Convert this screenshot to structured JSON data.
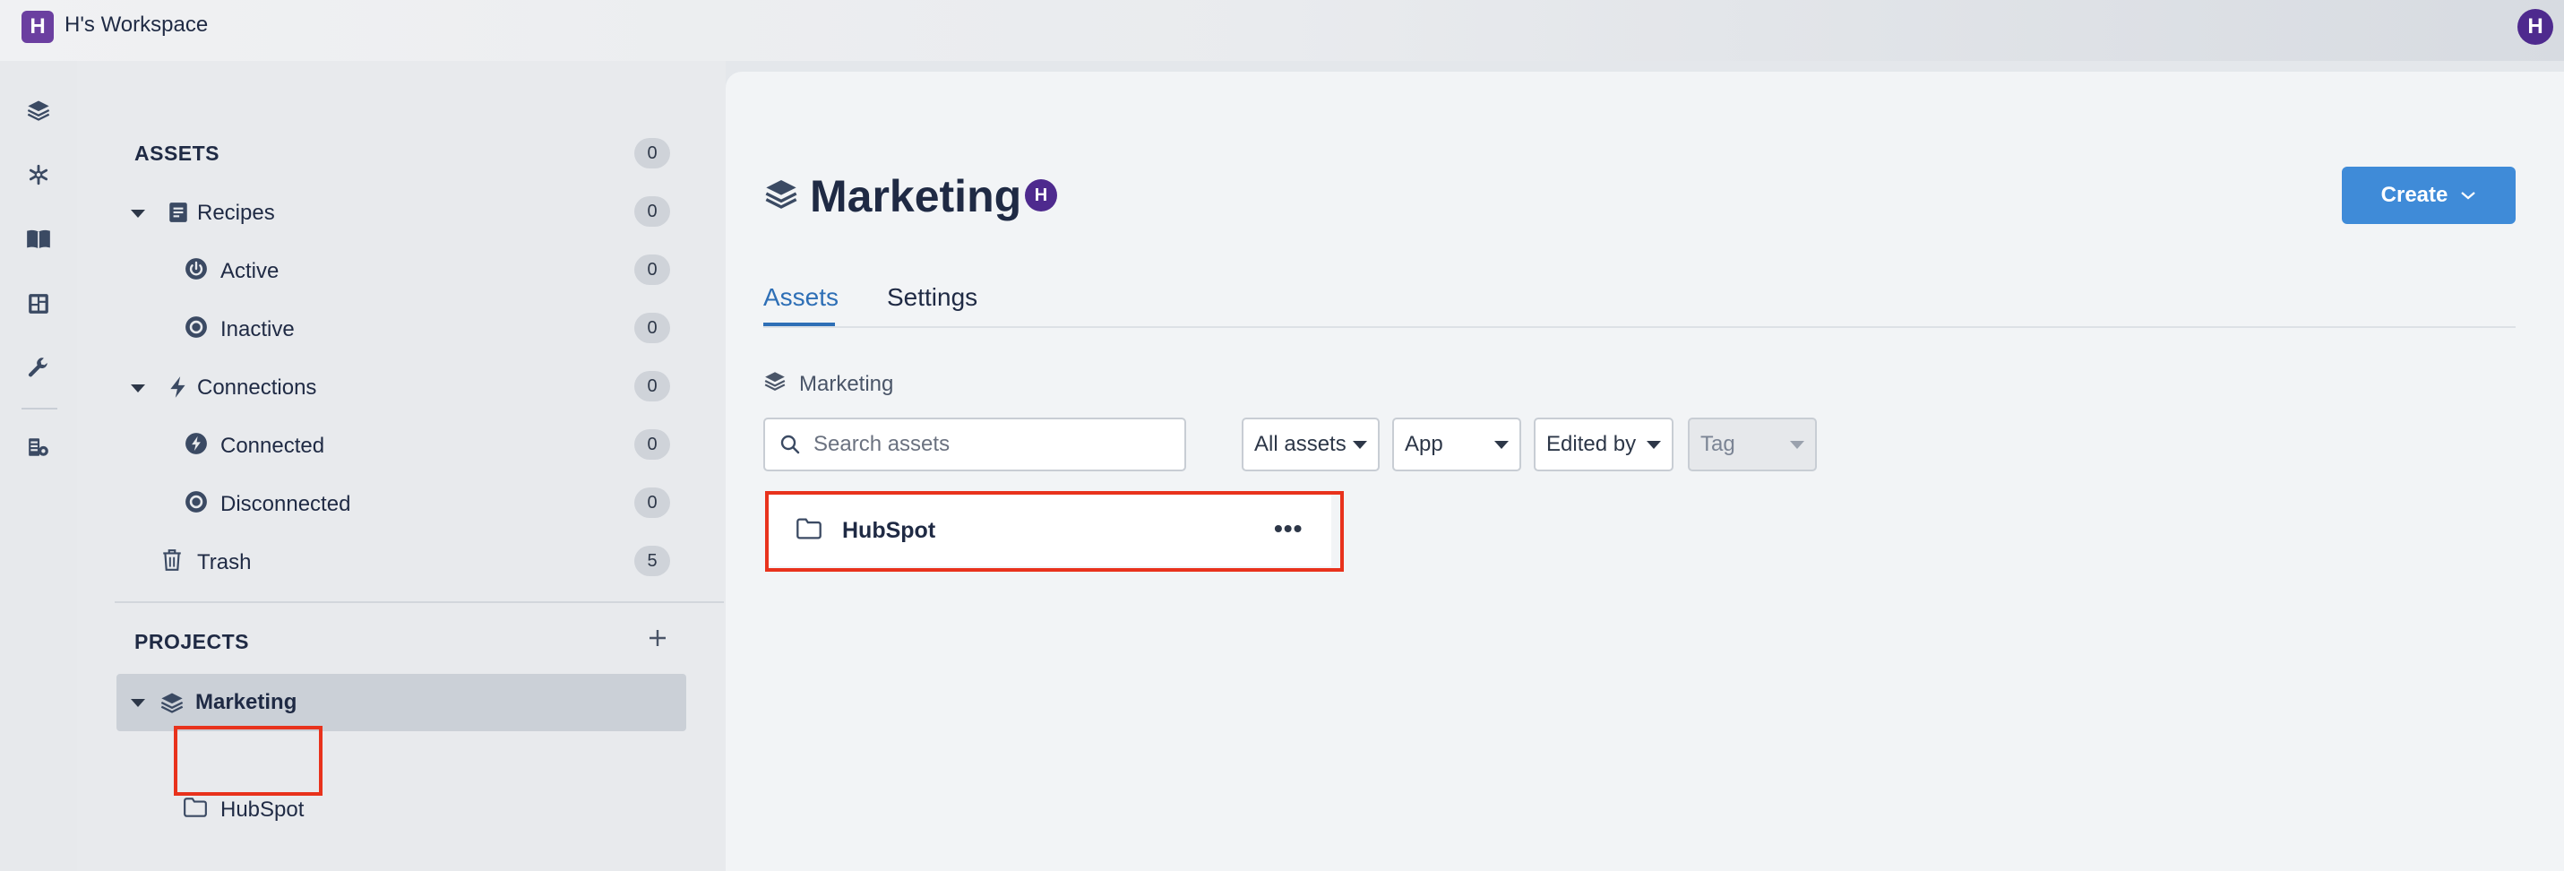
{
  "workspace": {
    "logo_letter": "H",
    "name": "H's Workspace",
    "avatar_letter": "H"
  },
  "rail": {
    "icons": [
      "layers-icon",
      "snowflake-icon",
      "book-icon",
      "dashboard-icon",
      "wrench-icon",
      "tools-icon"
    ]
  },
  "sidebar": {
    "assets_heading": "ASSETS",
    "assets_count": "0",
    "items": [
      {
        "label": "Recipes",
        "count": "0"
      },
      {
        "label": "Active",
        "count": "0"
      },
      {
        "label": "Inactive",
        "count": "0"
      },
      {
        "label": "Connections",
        "count": "0"
      },
      {
        "label": "Connected",
        "count": "0"
      },
      {
        "label": "Disconnected",
        "count": "0"
      },
      {
        "label": "Trash",
        "count": "5"
      }
    ],
    "projects_heading": "PROJECTS",
    "project": {
      "label": "Marketing",
      "folder": "HubSpot"
    }
  },
  "main": {
    "title": "Marketing",
    "owner_letter": "H",
    "create_label": "Create",
    "tabs": [
      "Assets",
      "Settings"
    ],
    "breadcrumb": "Marketing",
    "search_placeholder": "Search assets",
    "filters": [
      "All assets",
      "App",
      "Edited by",
      "Tag"
    ],
    "asset": {
      "name": "HubSpot",
      "more": "•••"
    }
  },
  "colors": {
    "accent": "#3f8bd8",
    "highlight": "#e8321c",
    "avatar": "#4e2a8e"
  }
}
